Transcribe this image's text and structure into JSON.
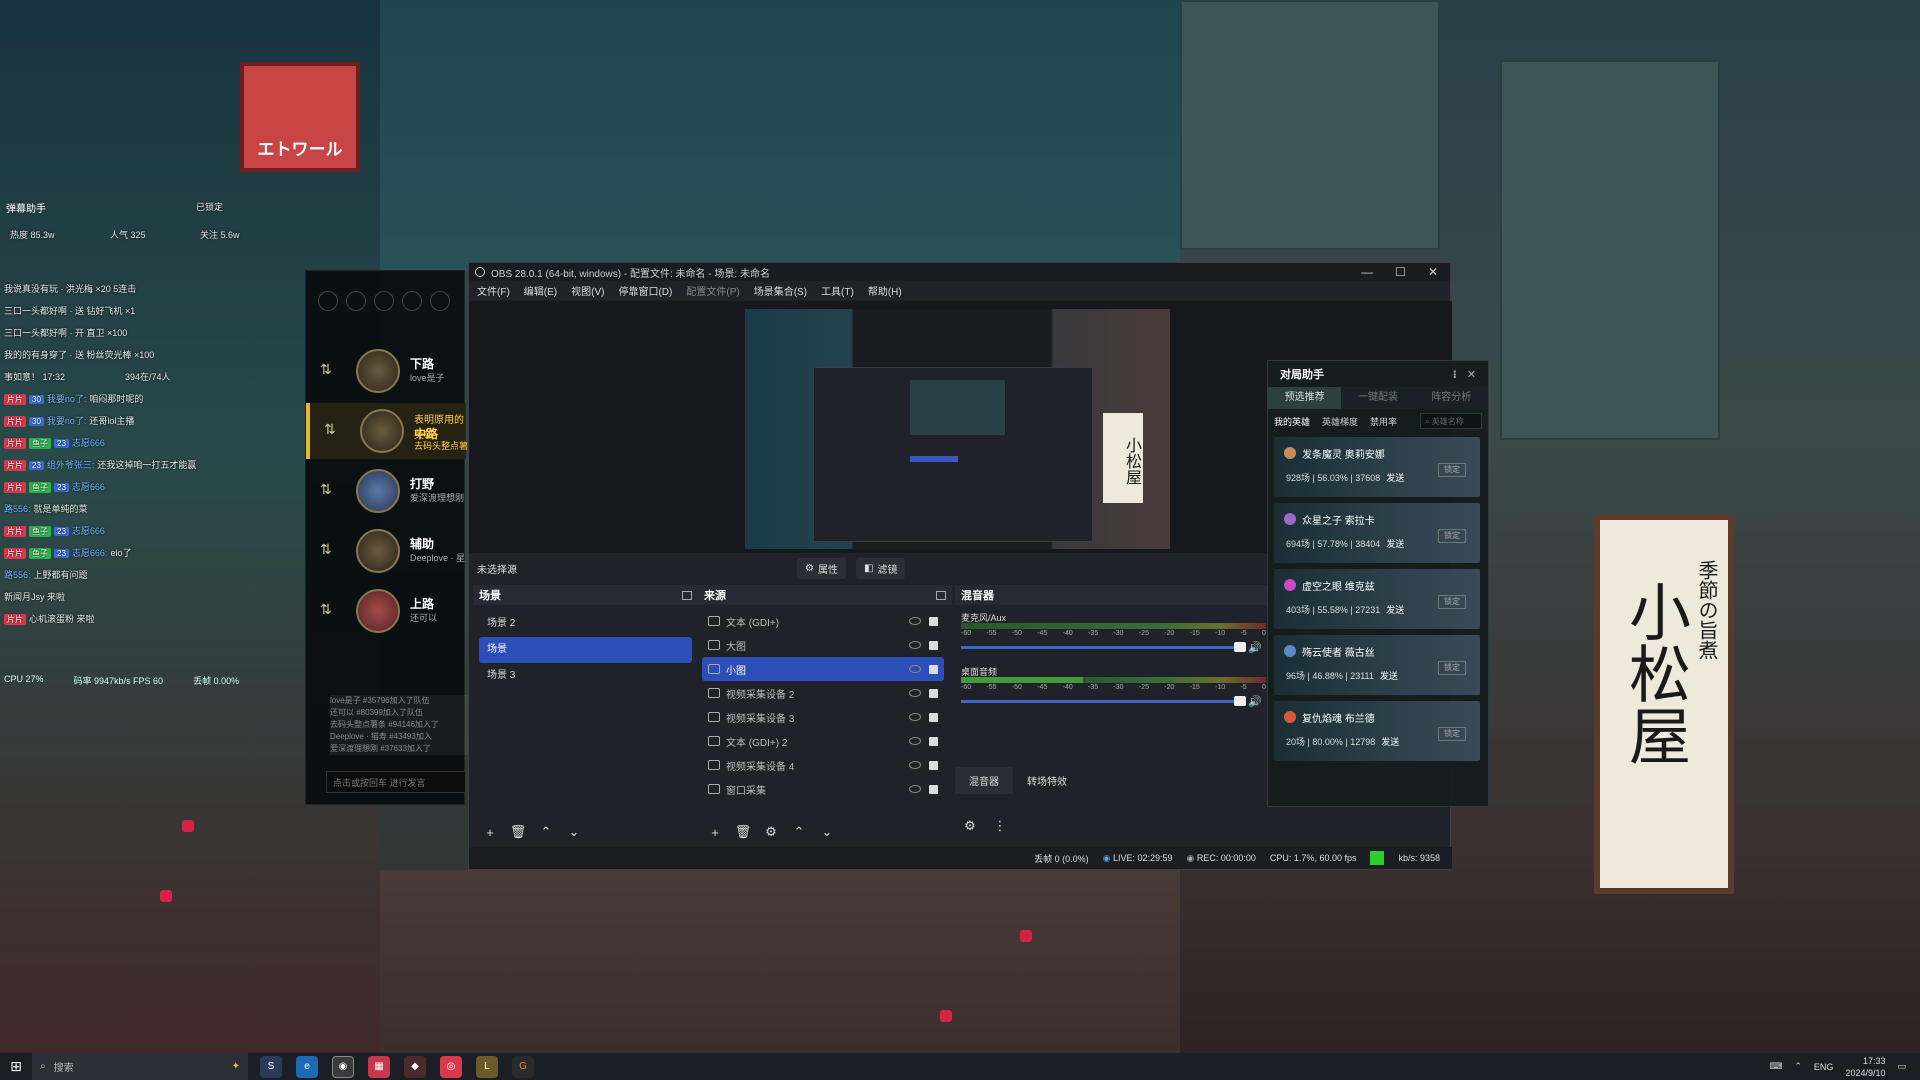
{
  "wallpaper": {
    "sign_main": "小松屋",
    "sign_sub": "季節の旨煮",
    "sign_red": "エトワール"
  },
  "chat_overlay": {
    "title": "弹幕助手",
    "status": "已锁定",
    "heat": "热度 85.3w",
    "viewers": "人气 325",
    "follows": "关注 5.6w",
    "lines": [
      {
        "text": "我说真没有玩 · 洪光梅   ×20 5连击"
      },
      {
        "text": "三口一头都好啊 · 送 钻好飞机 ×1"
      },
      {
        "text": "三口一头都好啊 · 开 直卫 ×100"
      },
      {
        "text": "我的的有身穿了 · 送 粉丝荧光棒 ×100"
      },
      {
        "text": "事如意！ 17:32",
        "right": "394在/74人"
      },
      {
        "badge": "片片",
        "lv": "30",
        "name": "我要no了:",
        "text": "咱闷那时呢的"
      },
      {
        "badge": "片片",
        "lv": "30",
        "name": "我要no了:",
        "text": "还哥lol主播"
      },
      {
        "badge": "片片",
        "fans": "鱼子",
        "lv": "23",
        "name": "志愿666",
        "text": ""
      },
      {
        "badge": "片片",
        "lv": "23",
        "name": "组外爷张三:",
        "text": "还我这掉咱一打五才能赢"
      },
      {
        "badge": "片片",
        "fans": "鱼子",
        "lv": "23",
        "name": "志愿666",
        "text": ""
      },
      {
        "name": "路556:",
        "text": "就是单纯的菜"
      },
      {
        "badge": "片片",
        "fans": "鱼子",
        "lv": "23",
        "name": "志愿666",
        "text": ""
      },
      {
        "badge": "片片",
        "fans": "鱼子",
        "lv": "23",
        "name": "志愿666:",
        "text": "elo了"
      },
      {
        "name": "路556:",
        "text": "上野都有问题"
      },
      {
        "name": "",
        "text": "新闻月Jsy 来啦"
      },
      {
        "badge": "片片",
        "name": "",
        "text": "心机滚蛋粉 来啦"
      }
    ],
    "stats": {
      "cpu": "CPU 27%",
      "net": "码率 9947kb/s FPS 60",
      "drop": "丢帧 0.00%"
    }
  },
  "role_panel": {
    "roles": [
      {
        "label": "下路",
        "sub": "love是子",
        "active": false
      },
      {
        "label": "中路",
        "sub": "去码头整点薯条",
        "tip": "表明原用的英雄",
        "active": true
      },
      {
        "label": "打野",
        "sub": "爱深渡理想刚",
        "active": false
      },
      {
        "label": "辅助",
        "sub": "Deeplove · 星",
        "active": false
      },
      {
        "label": "上路",
        "sub": "还可以",
        "active": false
      }
    ],
    "chat_log": [
      "love是子 #35796加入了队伍",
      "还可以 #80399加入了队伍",
      "去码头整点薯条 #94146加入了",
      "Deeplove · 猫寿 #43493加入",
      "爱深渡理想刚 #37633加入了"
    ],
    "input_placeholder": "点击或按回车 进行发言"
  },
  "obs": {
    "title": "OBS 28.0.1 (64-bit, windows) - 配置文件: 未命名 - 场景: 未命名",
    "menu": [
      "文件(F)",
      "编辑(E)",
      "视图(V)",
      "停靠窗口(D)",
      "配置文件(P)",
      "场景集合(S)",
      "工具(T)",
      "帮助(H)"
    ],
    "preview_sign": "小松屋",
    "no_source": "未选择源",
    "properties_label": "属性",
    "filters_label": "滤镜",
    "scenes": {
      "title": "场景",
      "items": [
        {
          "name": "场景 2",
          "active": false
        },
        {
          "name": "场景",
          "active": true
        },
        {
          "name": "场景 3",
          "active": false
        }
      ]
    },
    "sources": {
      "title": "来源",
      "items": [
        {
          "name": "文本 (GDI+)",
          "active": false
        },
        {
          "name": "大图",
          "active": false
        },
        {
          "name": "小图",
          "active": true
        },
        {
          "name": "视频采集设备 2",
          "active": false
        },
        {
          "name": "视频采集设备 3",
          "active": false
        },
        {
          "name": "文本 (GDI+) 2",
          "active": false
        },
        {
          "name": "视频采集设备 4",
          "active": false
        },
        {
          "name": "窗口采集",
          "active": false
        }
      ]
    },
    "mixer": {
      "title": "混音器",
      "channels": [
        {
          "name": "麦克风/Aux",
          "level": 1.0
        },
        {
          "name": "桌面音频",
          "level": 1.0
        }
      ],
      "ticks": [
        "-60",
        "-55",
        "-50",
        "-45",
        "-40",
        "-35",
        "-30",
        "-25",
        "-20",
        "-15",
        "-10",
        "-5",
        "0"
      ],
      "tab_mixer": "混音器",
      "tab_transitions": "转场特效"
    },
    "status": {
      "dropped": "丢帧 0 (0.0%)",
      "live": "LIVE: 02:29:59",
      "rec": "REC: 00:00:00",
      "cpu": "CPU: 1.7%, 60.00 fps",
      "kbs": "kb/s: 9358",
      "ok_color": "#2bcf2b"
    }
  },
  "helper": {
    "title": "对局助手",
    "tabs": [
      "预选推荐",
      "一键配装",
      "阵容分析"
    ],
    "subtabs": [
      "我的英雄",
      "英雄梯度",
      "禁用率"
    ],
    "search_placeholder": "英雄名称",
    "send_label": "发送",
    "lock_label": "锁定",
    "champions": [
      {
        "name": "发条魔灵 奥莉安娜",
        "stats": "928场 | 56.03% | 37608",
        "color": "#c88a5a"
      },
      {
        "name": "众星之子 索拉卡",
        "stats": "694场 | 57.78% | 38404",
        "color": "#9a6ac8"
      },
      {
        "name": "虚空之眼 维克兹",
        "stats": "403场 | 55.58% | 27231",
        "color": "#c84ac8"
      },
      {
        "name": "殇云使者 薇古丝",
        "stats": "96场 | 46.88% | 23111",
        "color": "#5a8ac8"
      },
      {
        "name": "复仇焰魂 布兰德",
        "stats": "20场 | 80.00% | 12798",
        "color": "#d85a3a"
      }
    ]
  },
  "taskbar": {
    "search_placeholder": "搜索",
    "lang": "ENG",
    "time": "17:33",
    "date": "2024/9/10"
  }
}
